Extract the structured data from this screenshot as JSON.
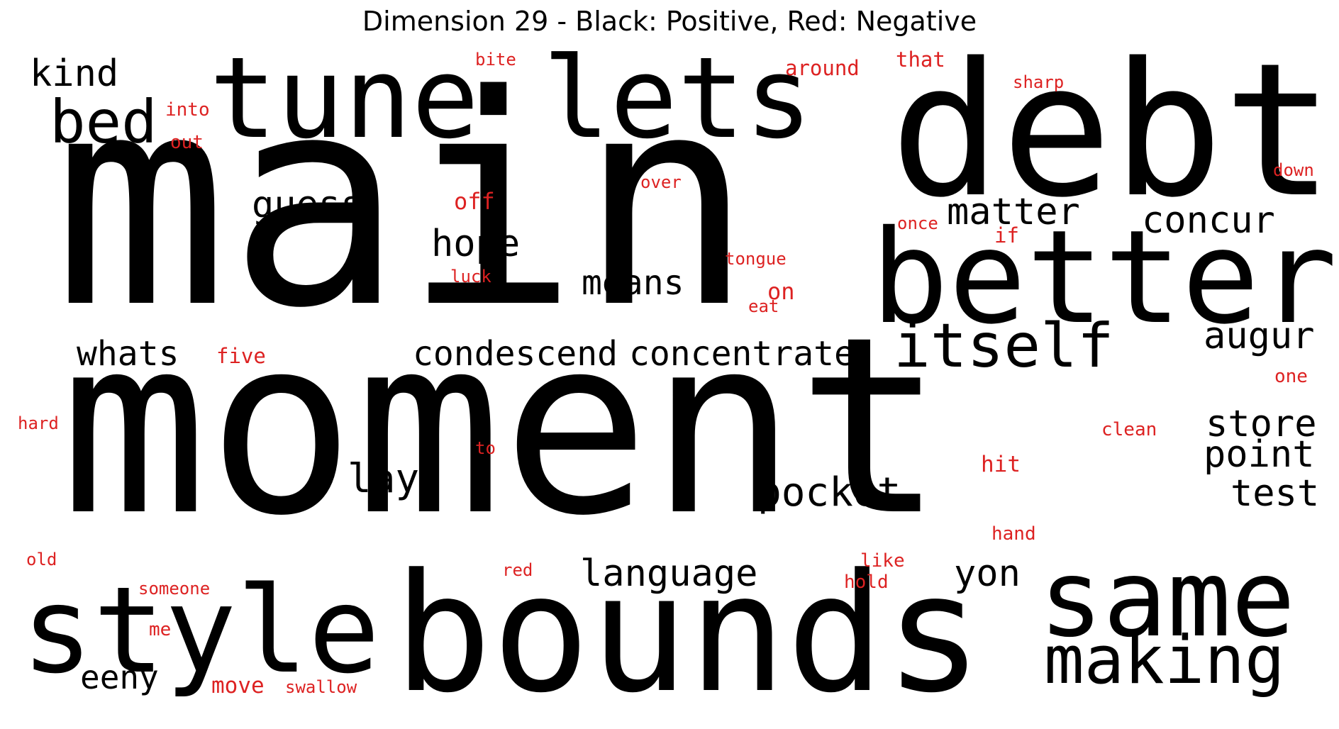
{
  "title": "Dimension 29 - Black: Positive, Red: Negative",
  "colors": {
    "positive": "#000000",
    "negative": "#dd2222"
  },
  "positive_words": [
    "main",
    "moment",
    "bounds",
    "debt",
    "tune",
    "lets",
    "better",
    "same",
    "style",
    "itself",
    "making",
    "bed",
    "kind",
    "guess",
    "hope",
    "matter",
    "concur",
    "means",
    "whats",
    "condescend",
    "concentrate",
    "augur",
    "store",
    "point",
    "test",
    "lay",
    "pocket",
    "language",
    "yon",
    "eeny"
  ],
  "negative_words": [
    "bite",
    "around",
    "that",
    "sharp",
    "into",
    "out",
    "down",
    "over",
    "off",
    "once",
    "if",
    "tongue",
    "luck",
    "on",
    "eat",
    "five",
    "one",
    "hard",
    "clean",
    "to",
    "hit",
    "hand",
    "old",
    "red",
    "like",
    "hold",
    "someone",
    "me",
    "move",
    "swallow"
  ]
}
